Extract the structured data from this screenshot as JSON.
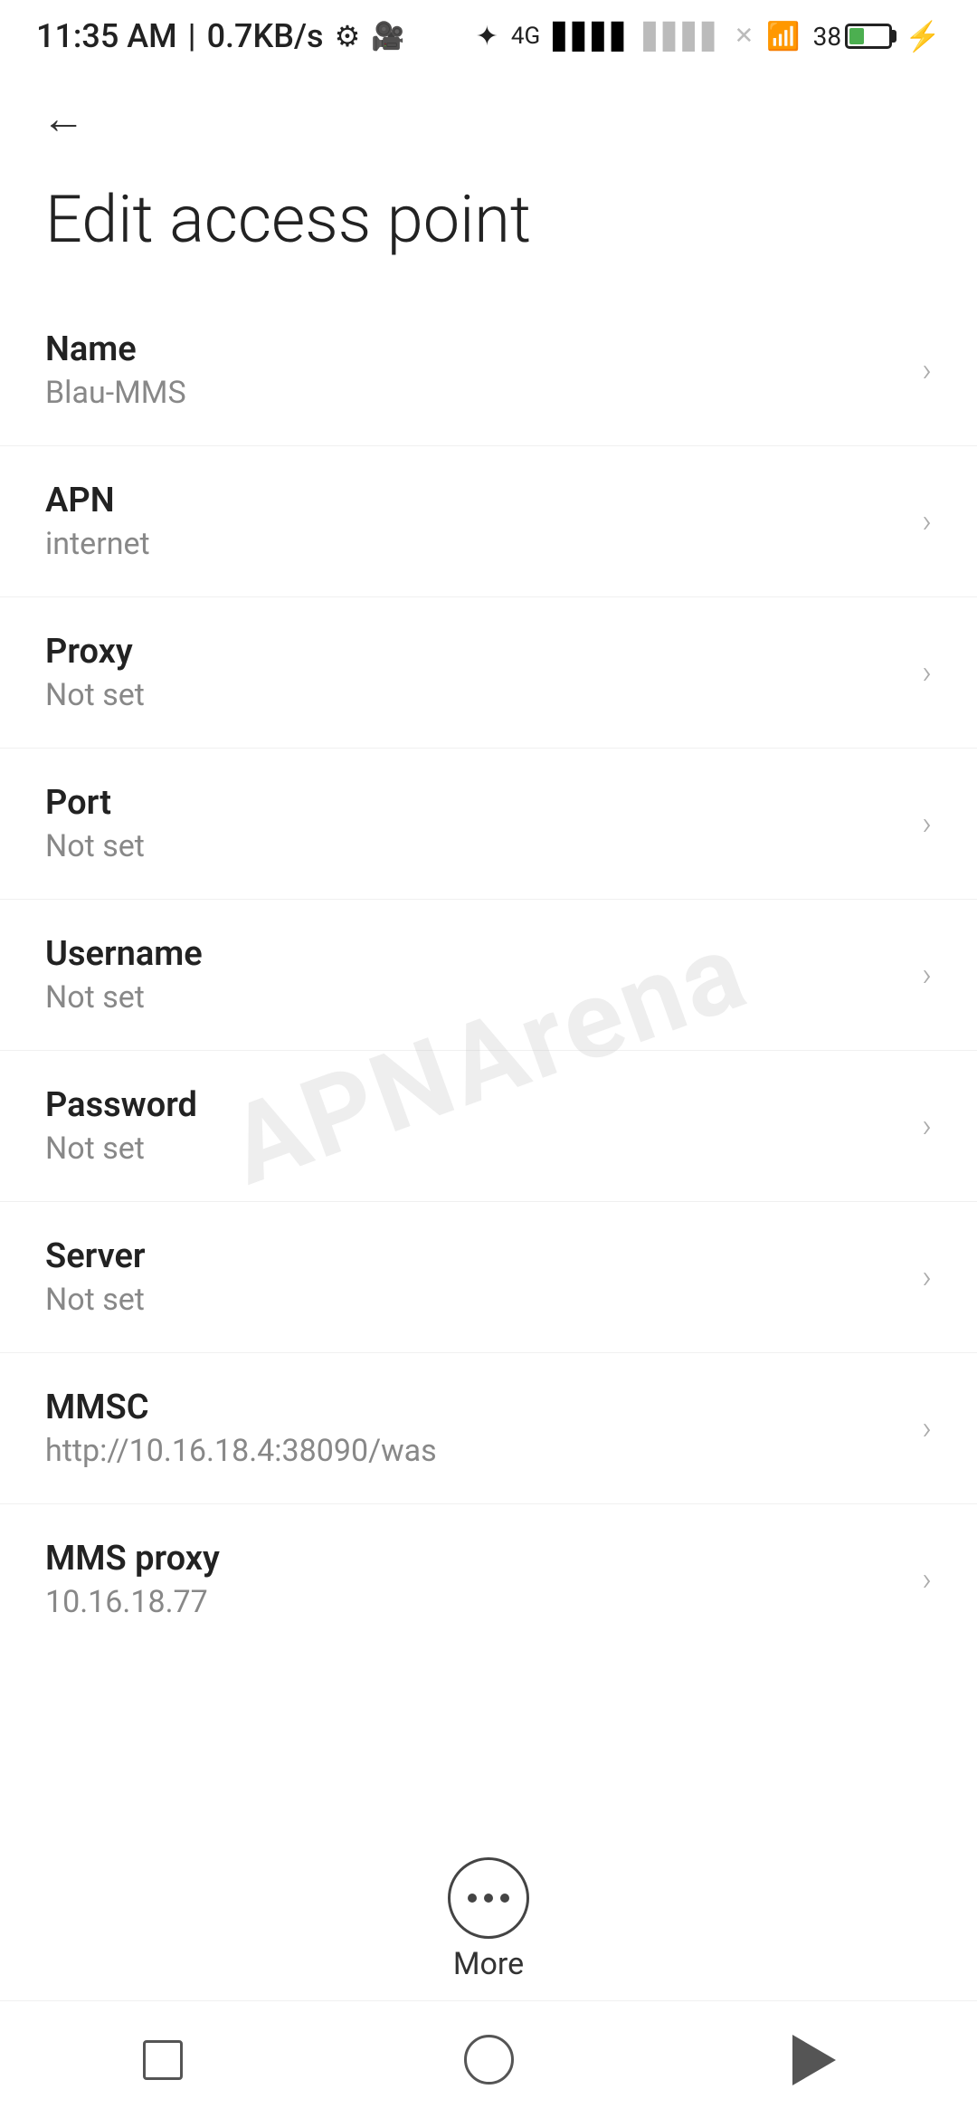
{
  "statusBar": {
    "time": "11:35 AM",
    "network_speed": "0.7KB/s",
    "battery_percent": "38"
  },
  "toolbar": {
    "back_label": "←"
  },
  "page": {
    "title": "Edit access point"
  },
  "settings_items": [
    {
      "label": "Name",
      "value": "Blau-MMS"
    },
    {
      "label": "APN",
      "value": "internet"
    },
    {
      "label": "Proxy",
      "value": "Not set"
    },
    {
      "label": "Port",
      "value": "Not set"
    },
    {
      "label": "Username",
      "value": "Not set"
    },
    {
      "label": "Password",
      "value": "Not set"
    },
    {
      "label": "Server",
      "value": "Not set"
    },
    {
      "label": "MMSC",
      "value": "http://10.16.18.4:38090/was"
    },
    {
      "label": "MMS proxy",
      "value": "10.16.18.77"
    }
  ],
  "more_button": {
    "label": "More"
  },
  "watermark": "APNArena",
  "nav": {
    "square": "",
    "circle": "",
    "triangle": ""
  }
}
